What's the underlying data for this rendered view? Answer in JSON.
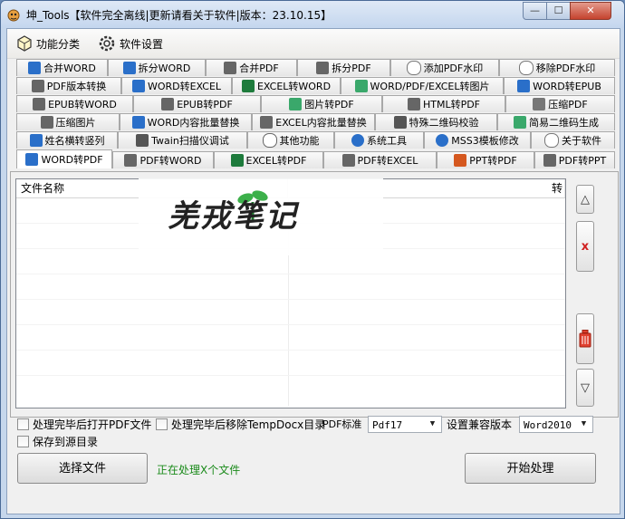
{
  "window": {
    "title": "坤_Tools【软件完全离线|更新请看关于软件|版本：23.10.15】",
    "minimize": "—",
    "maximize": "☐",
    "close": "✕"
  },
  "toolbar": {
    "category_label": "功能分类",
    "settings_label": "软件设置"
  },
  "tabs": [
    {
      "label": "合并WORD",
      "icon_color": "#2a6fc9"
    },
    {
      "label": "拆分WORD",
      "icon_color": "#2a6fc9"
    },
    {
      "label": "合并PDF",
      "icon_color": "#666666"
    },
    {
      "label": "拆分PDF",
      "icon_color": "#666666"
    },
    {
      "label": "添加PDF水印",
      "icon_color": "#777777"
    },
    {
      "label": "移除PDF水印",
      "icon_color": "#777777"
    },
    {
      "label": "PDF版本转换",
      "icon_color": "#666666"
    },
    {
      "label": "WORD转EXCEL",
      "icon_color": "#2a6fc9"
    },
    {
      "label": "EXCEL转WORD",
      "icon_color": "#1e7b3c"
    },
    {
      "label": "WORD/PDF/EXCEL转图片",
      "icon_color": "#3aa86b"
    },
    {
      "label": "WORD转EPUB",
      "icon_color": "#2a6fc9"
    },
    {
      "label": "EPUB转WORD",
      "icon_color": "#666666"
    },
    {
      "label": "EPUB转PDF",
      "icon_color": "#666666"
    },
    {
      "label": "图片转PDF",
      "icon_color": "#3aa86b"
    },
    {
      "label": "HTML转PDF",
      "icon_color": "#666666"
    },
    {
      "label": "压缩PDF",
      "icon_color": "#777777"
    },
    {
      "label": "压缩图片",
      "icon_color": "#666666"
    },
    {
      "label": "WORD内容批量替换",
      "icon_color": "#2a6fc9"
    },
    {
      "label": "EXCEL内容批量替换",
      "icon_color": "#666666"
    },
    {
      "label": "特殊二维码校验",
      "icon_color": "#555555"
    },
    {
      "label": "简易二维码生成",
      "icon_color": "#3aa86b"
    },
    {
      "label": "姓名横转竖列",
      "icon_color": "#2a6fc9"
    },
    {
      "label": "Twain扫描仪调试",
      "icon_color": "#555555"
    },
    {
      "label": "其他功能",
      "icon_color": "#666666"
    },
    {
      "label": "系统工具",
      "icon_color": "#2a6fc9"
    },
    {
      "label": "MSS3模板修改",
      "icon_color": "#2a6fc9"
    },
    {
      "label": "关于软件",
      "icon_color": "#777777"
    },
    {
      "label": "WORD转PDF",
      "icon_color": "#2a6fc9"
    },
    {
      "label": "PDF转WORD",
      "icon_color": "#666666"
    },
    {
      "label": "EXCEL转PDF",
      "icon_color": "#1e7b3c"
    },
    {
      "label": "PDF转EXCEL",
      "icon_color": "#666666"
    },
    {
      "label": "PPT转PDF",
      "icon_color": "#d5581f"
    },
    {
      "label": "PDF转PPT",
      "icon_color": "#666666"
    }
  ],
  "active_tab": "WORD转PDF",
  "file_list": {
    "col_name": "文件名称",
    "col_2": "转"
  },
  "watermark": {
    "text": "羌戎笔记"
  },
  "side_buttons": {
    "up": "△",
    "remove": "x",
    "down": "▽"
  },
  "options": {
    "open_after": "处理完毕后打开PDF文件",
    "remove_temp": "处理完毕后移除TempDocx目录",
    "save_to_source": "保存到源目录",
    "pdf_standard_label": "PDF标准",
    "pdf_standard_value": "Pdf17",
    "compat_label": "设置兼容版本",
    "compat_value": "Word2010"
  },
  "actions": {
    "select_files": "选择文件",
    "status": "正在处理X个文件",
    "start": "开始处理"
  }
}
